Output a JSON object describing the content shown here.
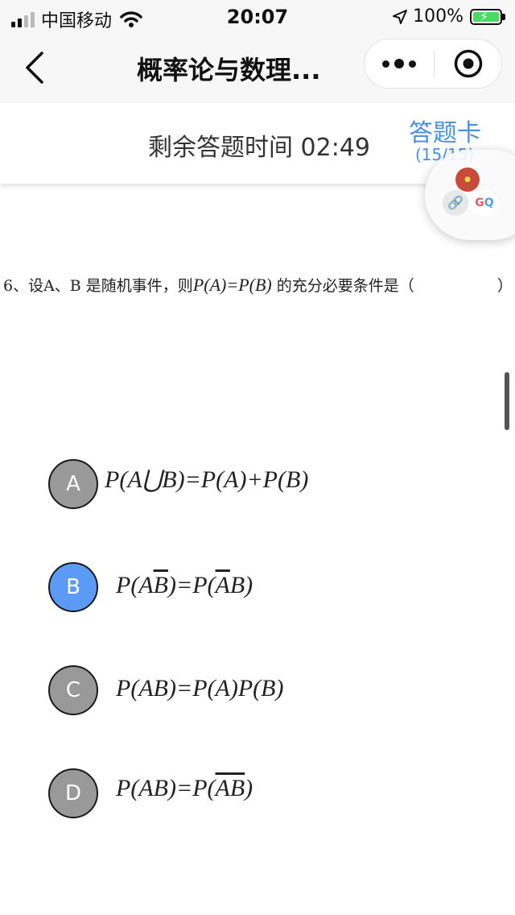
{
  "status_bar": {
    "carrier": "中国移动",
    "time": "20:07",
    "battery": "100%"
  },
  "nav": {
    "title": "概率论与数理..."
  },
  "timer": {
    "text": "剩余答题时间 02:49",
    "answer_card_label": "答题卡",
    "answer_count": "(15/15)"
  },
  "question": {
    "prefix": "6、设A、B 是随机事件，则",
    "formula": "P(A)=P(B)",
    "suffix": "的充分必要条件是（",
    "close": "）"
  },
  "options": [
    {
      "letter": "A",
      "formula": "P(A⋃B)=P(A)+P(B)",
      "selected": false
    },
    {
      "letter": "B",
      "f1": "P(A",
      "f2": "B",
      "f3": ")=P(",
      "f4": "A",
      "f5": "B)",
      "selected": true
    },
    {
      "letter": "C",
      "formula": "P(AB)=P(A)P(B)",
      "selected": false
    },
    {
      "letter": "D",
      "f1": "P(AB)=P(",
      "f2": "A",
      "f3": "B",
      "f4": ")",
      "selected": false
    }
  ],
  "colors": {
    "accent": "#4a90e2",
    "selected_option": "#5b9bf5",
    "unselected_option": "#999999"
  }
}
